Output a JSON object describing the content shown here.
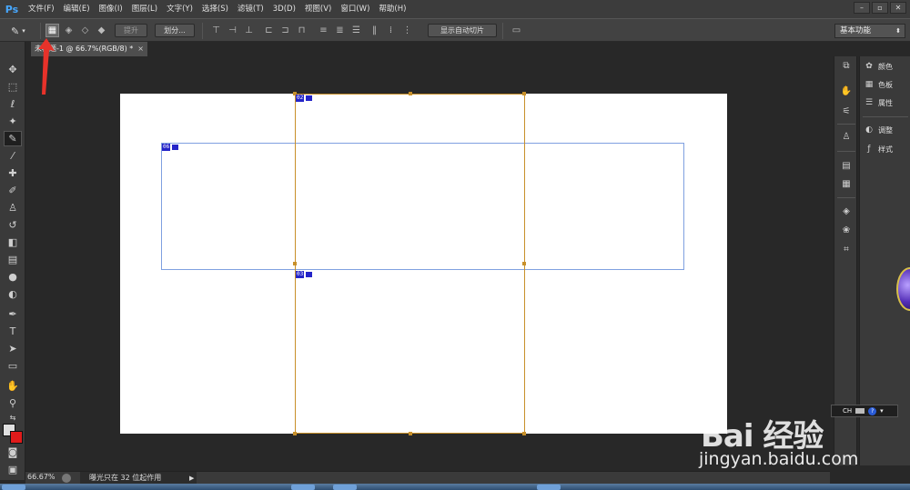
{
  "app": {
    "logo": "Ps",
    "menus": [
      "文件(F)",
      "编辑(E)",
      "图像(I)",
      "图层(L)",
      "文字(Y)",
      "选择(S)",
      "滤镜(T)",
      "3D(D)",
      "视图(V)",
      "窗口(W)",
      "帮助(H)"
    ],
    "window_controls": [
      "–",
      "▫",
      "✕"
    ]
  },
  "options_bar": {
    "promote_label": "提升",
    "divide_label": "划分...",
    "show_auto_slices_label": "显示自动切片",
    "workspace": "基本功能"
  },
  "document": {
    "tab_title": "未标题-1 @ 66.7%(RGB/8) *",
    "tab_close": "×"
  },
  "slices": {
    "badge_1": "02",
    "badge_2": "06",
    "badge_3": "03"
  },
  "status": {
    "zoom": "66.67%",
    "message": "曝光只在 32 位起作用",
    "arrow": "▶"
  },
  "panels": {
    "items": [
      "颜色",
      "色板",
      "属性",
      "调整",
      "样式"
    ]
  },
  "ch_widget": {
    "label": "CH",
    "help": "?"
  },
  "watermark": {
    "logo": "Bai 经验",
    "url": "jingyan.baidu.com"
  },
  "colors": {
    "foreground": "#e0e0e0",
    "background": "#e01b1b",
    "slice_line": "#c8902a",
    "slice_selection": "#7fa0e0",
    "slice_badge": "#2424c8"
  }
}
